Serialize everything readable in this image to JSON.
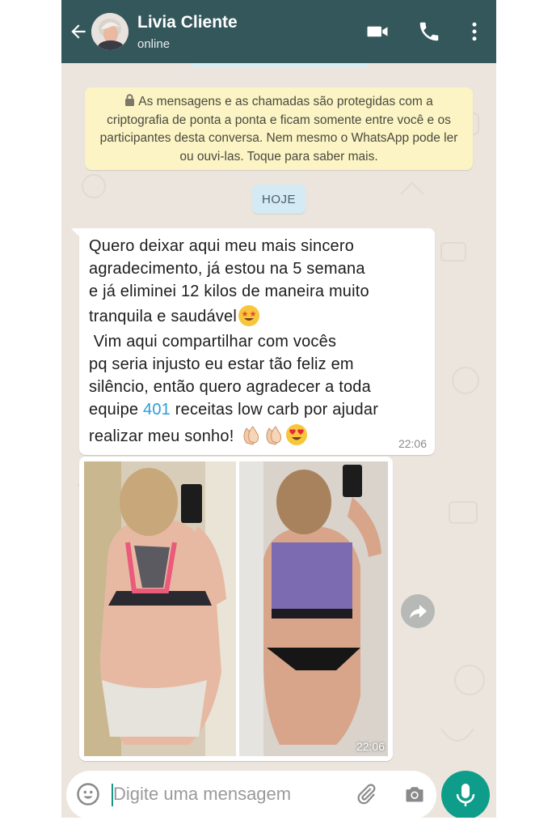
{
  "header": {
    "contact_name": "Livia Cliente",
    "status": "online",
    "color": "#33575b"
  },
  "encryption_notice": "As mensagens e as chamadas são protegidas com a criptografia de ponta a ponta e ficam somente entre você e os participantes desta conversa. Nem mesmo o WhatsApp pode ler ou ouvi-las. Toque para saber mais.",
  "date_chip": "HOJE",
  "message": {
    "lines": [
      "Quero deixar aqui meu mais sincero",
      "agradecimento, já estou na 5 semana",
      "e já eliminei 12 kilos de maneira muito",
      "tranquila e saudável",
      " Vim aqui compartilhar com vocês",
      "pq seria injusto eu estar tão feliz em",
      "silêncio, então quero agradecer a toda",
      "equipe",
      "401",
      "receitas low carb por ajudar",
      "realizar meu sonho!"
    ],
    "time": "22:06",
    "link_color": "#2b9fd6"
  },
  "image_message": {
    "time": "22:06"
  },
  "composer": {
    "placeholder": "Digite uma mensagem",
    "accent": "#0e9d8a"
  },
  "icons": [
    "back-arrow-icon",
    "video-call-icon",
    "phone-icon",
    "more-options-icon",
    "lock-icon",
    "star-struck-emoji",
    "clapping-hands-emoji",
    "heart-eyes-emoji",
    "forward-icon",
    "emoji-icon",
    "attach-icon",
    "camera-icon",
    "mic-icon"
  ]
}
